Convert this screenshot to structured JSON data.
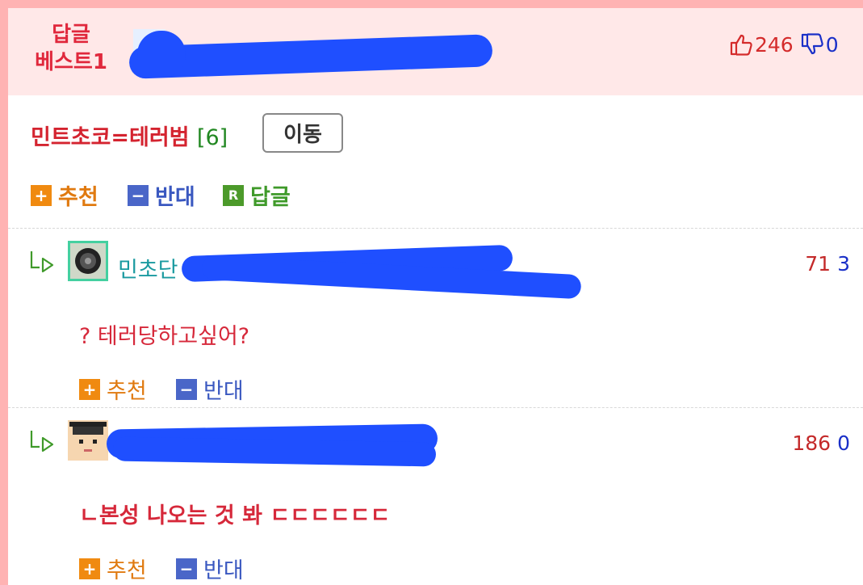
{
  "best_header": {
    "label_line1": "답글",
    "label_line2": "베스트1",
    "up_count": "246",
    "down_count": "0"
  },
  "post": {
    "title": "민트초코=테러범",
    "reply_count": "[6]",
    "move_button": "이동",
    "actions": {
      "recommend": "추천",
      "oppose": "반대",
      "reply": "답글",
      "reply_icon_letter": "R"
    }
  },
  "replies": [
    {
      "nickname": "민초단",
      "up": "71",
      "down": "3",
      "text": "? 테러당하고싶어?",
      "recommend": "추천",
      "oppose": "반대"
    },
    {
      "nickname": "",
      "up": "186",
      "down": "0",
      "text": "ㄴ본성 나오는 것 봐 ㄷㄷㄷㄷㄷㄷ",
      "recommend": "추천",
      "oppose": "반대"
    }
  ],
  "colors": {
    "accent_red": "#d4232f",
    "up_orange": "#f08a10",
    "down_blue": "#4a66c8",
    "reply_green": "#4c9a2a",
    "scribble_blue": "#1f4fff"
  }
}
